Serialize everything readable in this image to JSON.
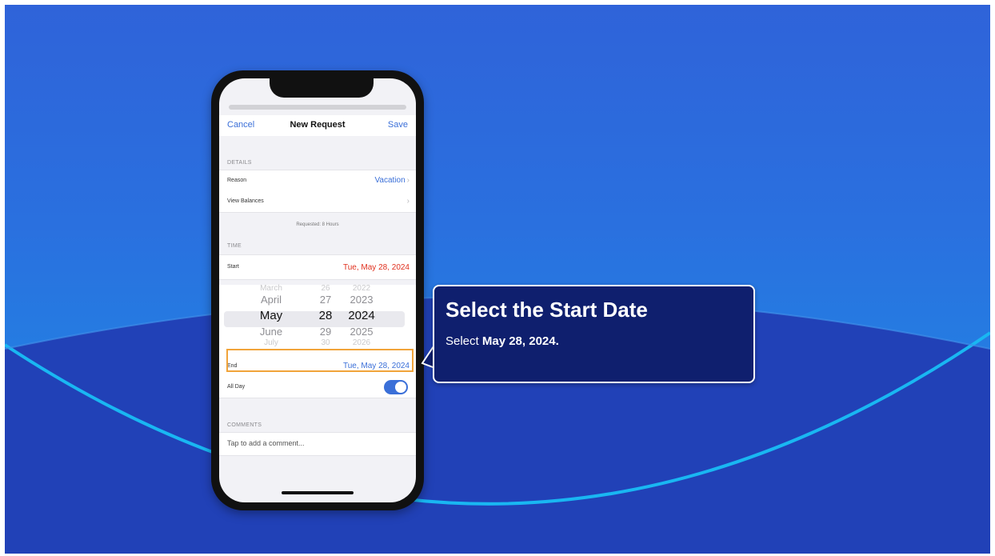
{
  "tutorial": {
    "title": "Select the Start Date",
    "instruction_prefix": "Select ",
    "instruction_bold": "May 28, 2024."
  },
  "app": {
    "nav": {
      "cancel": "Cancel",
      "title": "New Request",
      "save": "Save"
    },
    "details_label": "DETAILS",
    "reason_label": "Reason",
    "reason_value": "Vacation",
    "view_balances_label": "View Balances",
    "requested_note": "Requested: 8 Hours",
    "time_label": "TIME",
    "start_label": "Start",
    "start_value": "Tue, May 28, 2024",
    "picker": {
      "months": [
        "March",
        "April",
        "May",
        "June",
        "July"
      ],
      "days": [
        "26",
        "27",
        "28",
        "29",
        "30"
      ],
      "years": [
        "2022",
        "2023",
        "2024",
        "2025",
        "2026"
      ],
      "selected_month": "May",
      "selected_day": "28",
      "selected_year": "2024"
    },
    "end_label": "End",
    "end_value": "Tue, May 28, 2024",
    "all_day_label": "All Day",
    "all_day_on": true,
    "comments_label": "COMMENTS",
    "comment_placeholder": "Tap to add a comment..."
  },
  "colors": {
    "accent_blue": "#3a6fd8",
    "start_red": "#e0301e",
    "highlight_orange": "#f1a43a",
    "callout_bg": "#0f1f6e",
    "background_top": "#2f63d9",
    "background_bottom": "#2141b7"
  }
}
